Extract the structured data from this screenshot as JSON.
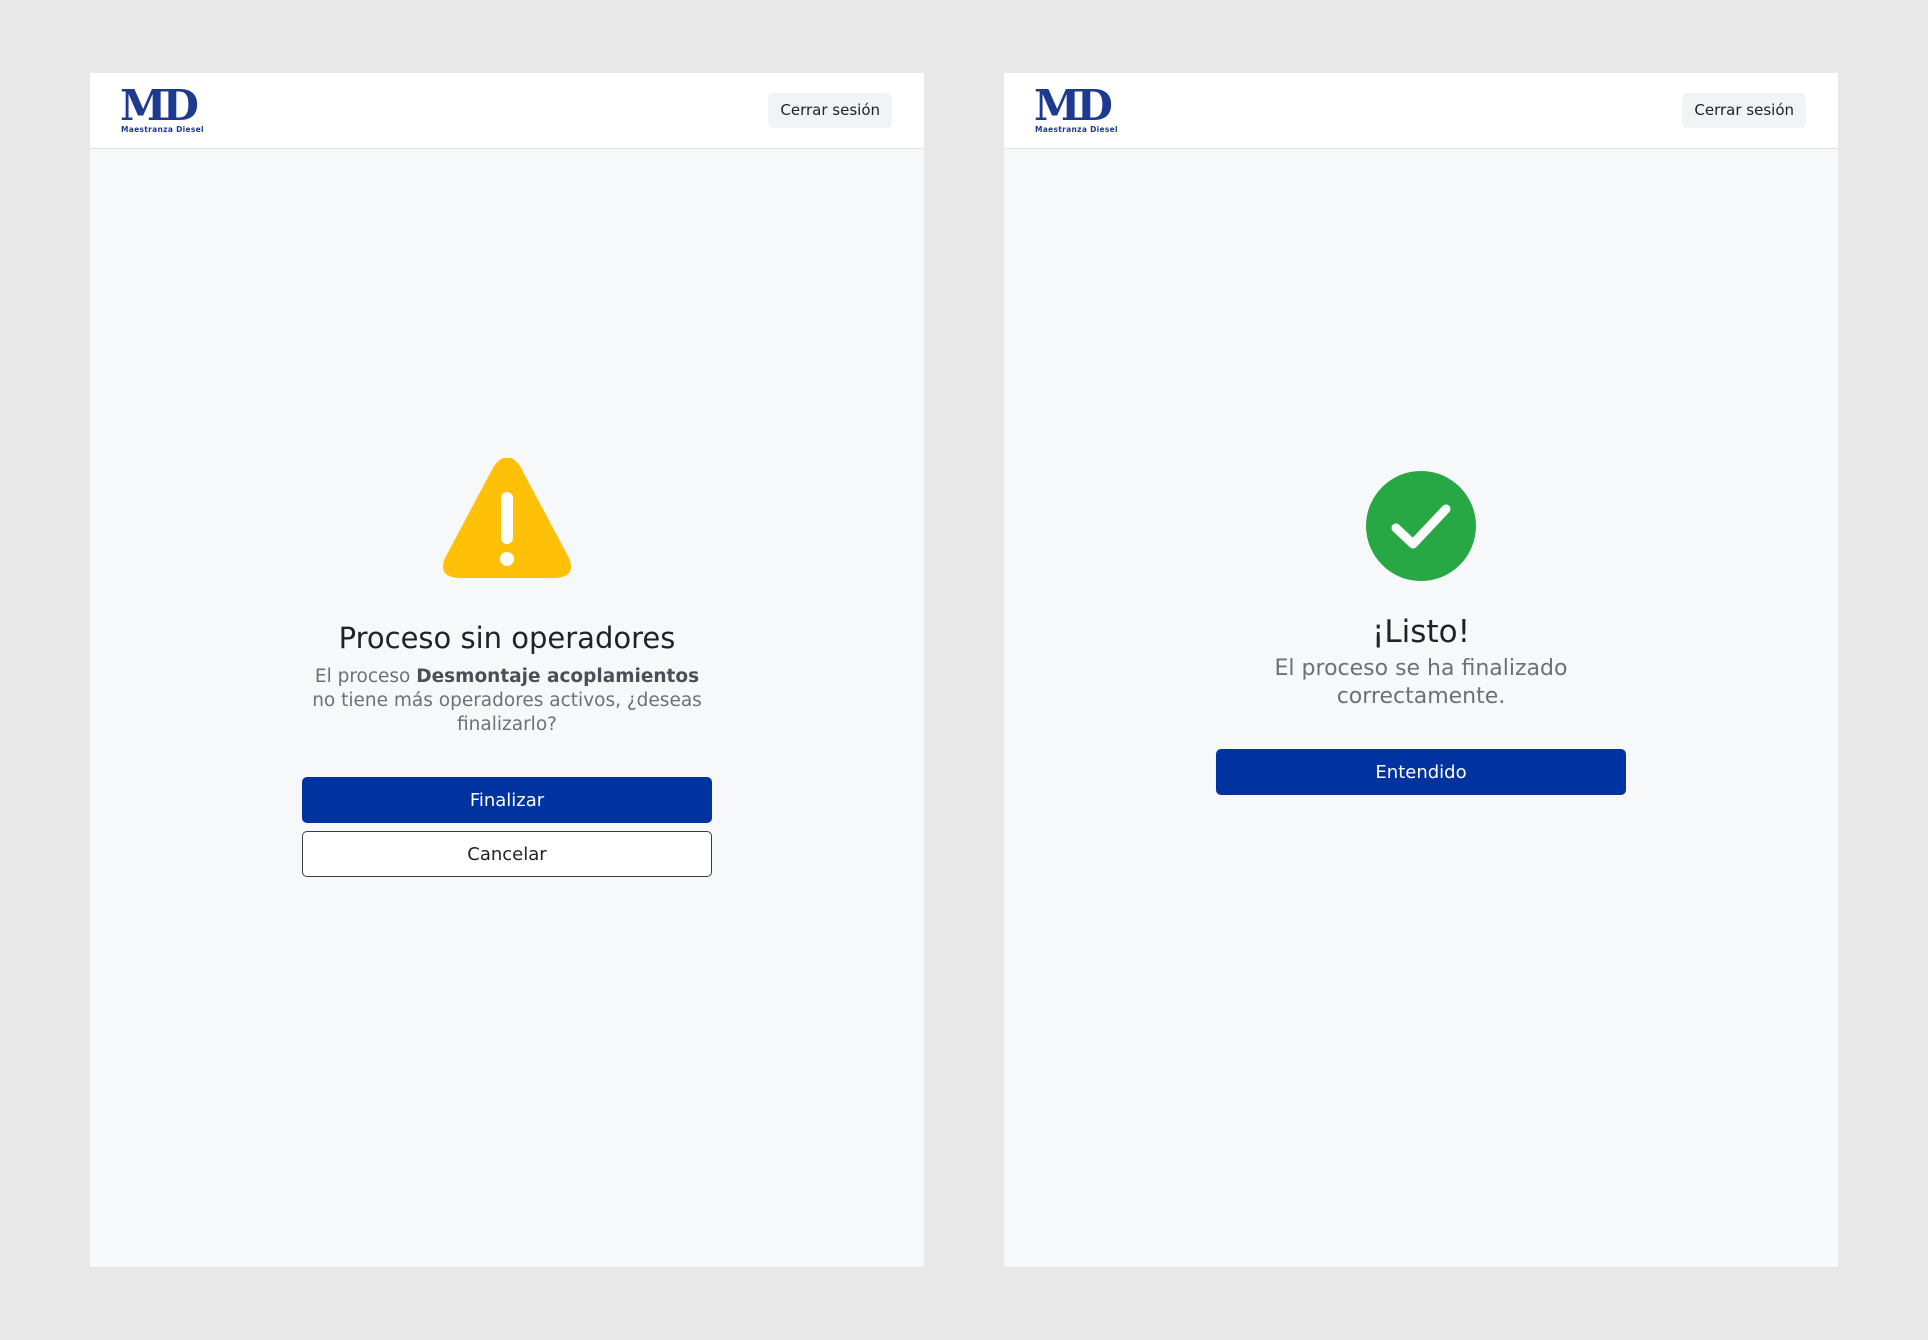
{
  "brand": {
    "logo_letters": "MD",
    "logo_subtitle": "Maestranza Diesel",
    "color": "#1d3a8f"
  },
  "header": {
    "logout_label": "Cerrar sesión"
  },
  "warning_dialog": {
    "icon": "warning-icon",
    "icon_color": "#ffc107",
    "title": "Proceso sin operadores",
    "message_prefix": "El proceso ",
    "process_name": "Desmontaje acoplamientos",
    "message_suffix": " no tiene más operadores activos, ¿deseas finalizarlo?",
    "confirm_label": "Finalizar",
    "cancel_label": "Cancelar"
  },
  "success_dialog": {
    "icon": "check-circle-icon",
    "icon_color": "#28a745",
    "title": "¡Listo!",
    "message": "El proceso se ha finalizado correctamente.",
    "ack_label": "Entendido"
  },
  "colors": {
    "primary": "#0033a0",
    "background": "#f7f8fa",
    "page_background": "#e8e8e8"
  }
}
